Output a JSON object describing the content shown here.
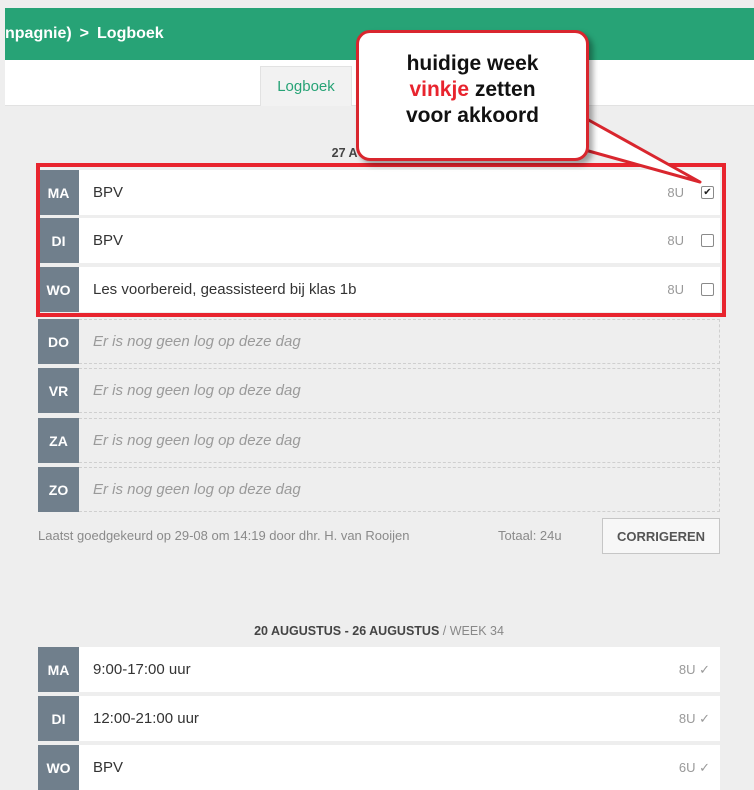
{
  "header": {
    "breadcrumb_start": "npagnie)",
    "breadcrumb_sep": ">",
    "breadcrumb_current": "Logboek"
  },
  "tabs": [
    {
      "label": "Logboek"
    }
  ],
  "week1": {
    "title": "27 AUGUSTUS -",
    "rows": [
      {
        "day": "MA",
        "text": "BPV",
        "hours": "8U",
        "checked": true
      },
      {
        "day": "DI",
        "text": "BPV",
        "hours": "8U",
        "checked": false
      },
      {
        "day": "WO",
        "text": "Les voorbereid, geassisteerd bij klas 1b",
        "hours": "8U",
        "checked": false
      },
      {
        "day": "DO",
        "text": "Er is nog geen log op deze dag"
      },
      {
        "day": "VR",
        "text": "Er is nog geen log op deze dag"
      },
      {
        "day": "ZA",
        "text": "Er is nog geen log op deze dag"
      },
      {
        "day": "ZO",
        "text": "Er is nog geen log op deze dag"
      }
    ],
    "approved_text": "Laatst goedgekeurd op 29-08 om 14:19 door dhr. H. van Rooijen",
    "total": "Totaal: 24u",
    "button": "CORRIGEREN"
  },
  "week2": {
    "title_dates": "20 AUGUSTUS - 26 AUGUSTUS",
    "title_week": " / WEEK 34",
    "rows": [
      {
        "day": "MA",
        "text": "9:00-17:00 uur",
        "hours": "8U ✓"
      },
      {
        "day": "DI",
        "text": "12:00-21:00 uur",
        "hours": "8U ✓"
      },
      {
        "day": "WO",
        "text": "BPV",
        "hours": "6U ✓"
      }
    ]
  },
  "callout": {
    "line1": "huidige week",
    "line2_red": "vinkje",
    "line2_rest": " zetten",
    "line3": "voor akkoord"
  },
  "colors": {
    "accent": "#27a376",
    "highlight": "#e8242e",
    "day_badge": "#707f8c"
  }
}
